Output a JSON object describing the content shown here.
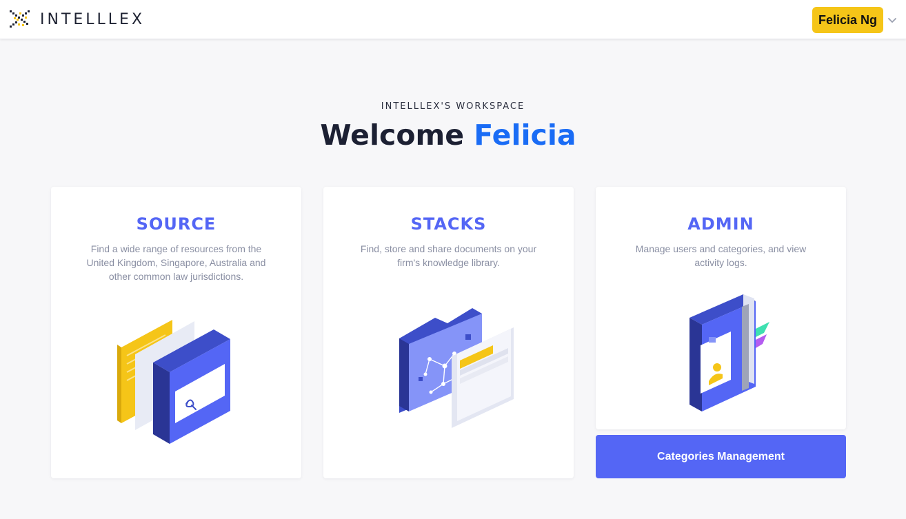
{
  "header": {
    "brand": "INTELLLEX",
    "user_name": "Felicia Ng"
  },
  "hero": {
    "eyebrow": "INTELLLEX'S WORKSPACE",
    "welcome": "Welcome",
    "first_name": "Felicia"
  },
  "cards": [
    {
      "title": "SOURCE",
      "description": "Find a wide range of resources from the United Kingdom, Singapore, Australia and other common law jurisdictions.",
      "icon": "source-illustration"
    },
    {
      "title": "STACKS",
      "description": "Find, store and share documents on your firm's knowledge library.",
      "icon": "stacks-illustration"
    },
    {
      "title": "ADMIN",
      "description": "Manage users and categories, and view activity logs.",
      "icon": "admin-illustration"
    }
  ],
  "admin_action": {
    "label": "Categories Management"
  },
  "colors": {
    "accent": "#5466f5",
    "highlight": "#1a6cf5",
    "badge": "#f5c518",
    "background": "#f7f7f9"
  }
}
